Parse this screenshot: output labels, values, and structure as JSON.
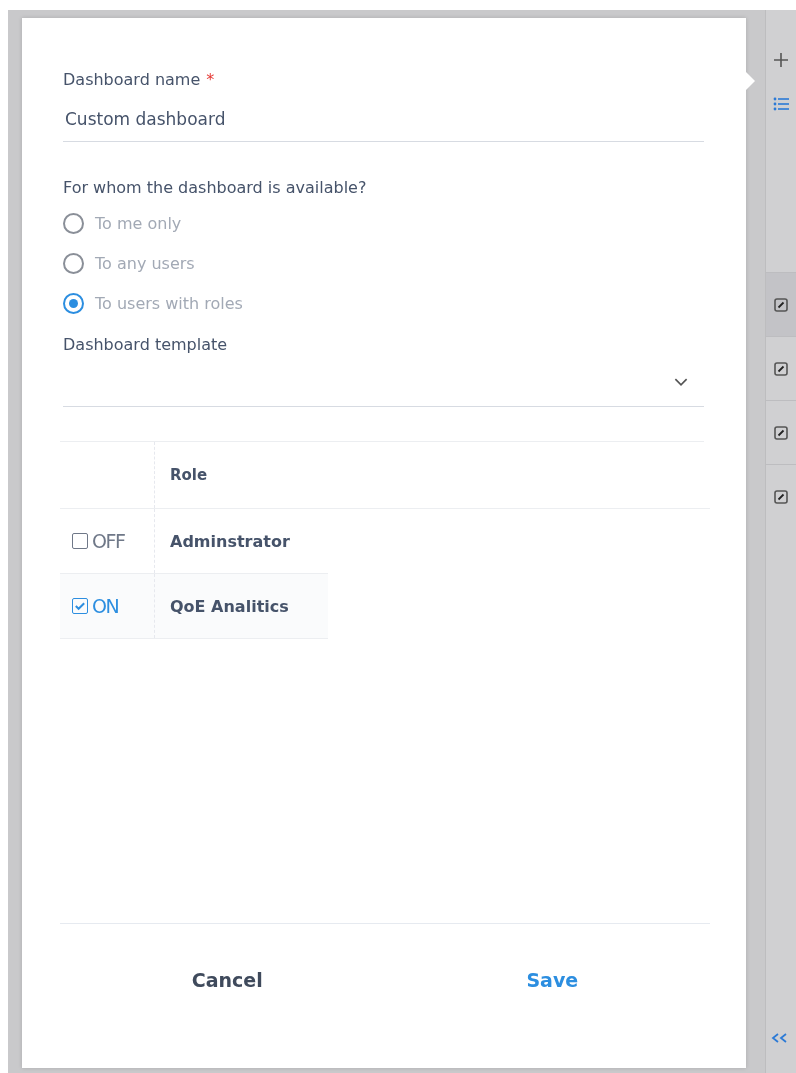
{
  "dialog": {
    "name_field": {
      "label": "Dashboard name",
      "required_mark": "*",
      "value": "Custom dashboard"
    },
    "availability": {
      "question": "For whom the dashboard is available?",
      "options": [
        {
          "label": "To me only",
          "selected": false
        },
        {
          "label": "To any users",
          "selected": false
        },
        {
          "label": "To users with roles",
          "selected": true
        }
      ]
    },
    "template_field": {
      "label": "Dashboard template"
    },
    "roles_table": {
      "columns": [
        "Role"
      ],
      "rows": [
        {
          "toggle": "OFF",
          "checked": false,
          "role": "Adminstrator"
        },
        {
          "toggle": "ON",
          "checked": true,
          "role": "QoE Analitics"
        }
      ]
    },
    "buttons": [
      {
        "label": "Cancel",
        "kind": "secondary"
      },
      {
        "label": "Save",
        "kind": "primary"
      }
    ]
  }
}
